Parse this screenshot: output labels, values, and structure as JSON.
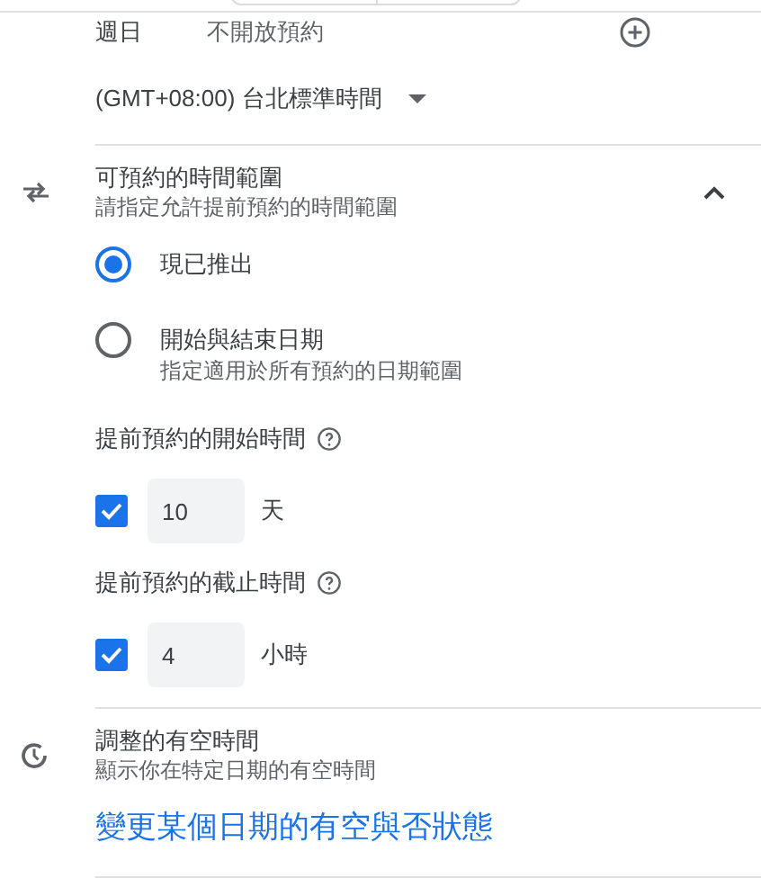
{
  "weekday_row": {
    "day": "週日",
    "status": "不開放預約"
  },
  "timezone": {
    "value": "(GMT+08:00) 台北標準時間"
  },
  "booking_window": {
    "title": "可預約的時間範圍",
    "subtitle": "請指定允許提前預約的時間範圍",
    "expanded": true,
    "options": [
      {
        "label": "現已推出",
        "selected": true
      },
      {
        "label": "開始與結束日期",
        "description": "指定適用於所有預約的日期範圍",
        "selected": false
      }
    ],
    "limits": [
      {
        "label": "提前預約的開始時間",
        "checked": true,
        "value": "10",
        "unit": "天"
      },
      {
        "label": "提前預約的截止時間",
        "checked": true,
        "value": "4",
        "unit": "小時"
      }
    ]
  },
  "adjusted_availability": {
    "title": "調整的有空時間",
    "subtitle": "顯示你在特定日期的有空時間",
    "link": "變更某個日期的有空與否狀態"
  }
}
